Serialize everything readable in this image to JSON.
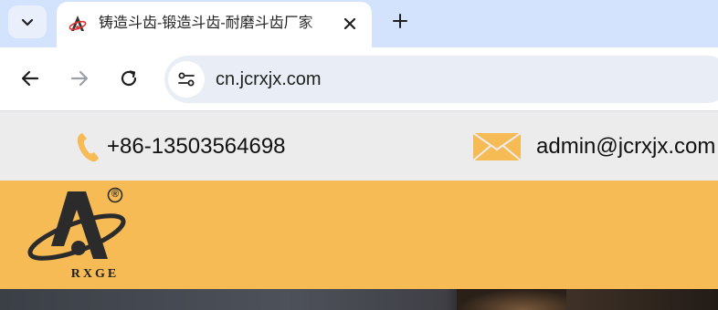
{
  "browser": {
    "tab": {
      "title": "铸造斗齿-锻造斗齿-耐磨斗齿厂家"
    },
    "address_bar": {
      "url": "cn.jcrxjx.com"
    },
    "icons": {
      "tab_search": "chevron-down-icon",
      "close": "close-icon",
      "new_tab": "plus-icon",
      "back": "arrow-left-icon",
      "forward": "arrow-right-icon",
      "reload": "reload-icon",
      "site_info": "tune-icon"
    }
  },
  "page": {
    "contact": {
      "phone": "+86-13503564698",
      "email": "admin@jcrxjx.com"
    },
    "logo": {
      "text": "RXGE",
      "registered": "®"
    },
    "colors": {
      "header_bg": "#f6bb55",
      "contact_bg": "#ececec",
      "accent": "#f6bb55"
    }
  }
}
